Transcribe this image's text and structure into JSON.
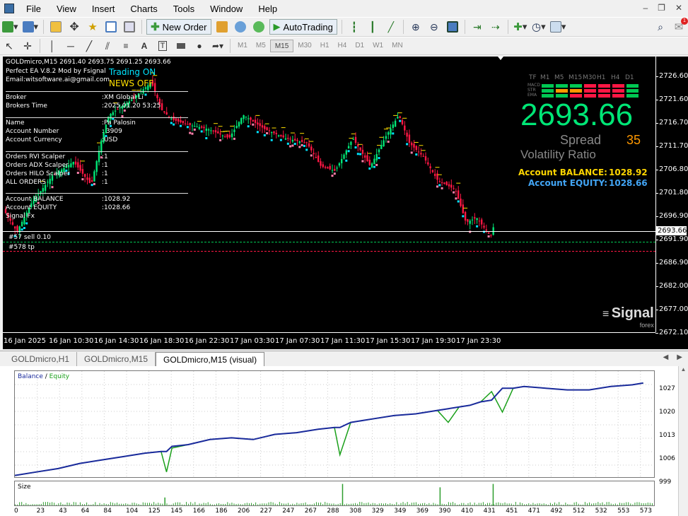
{
  "menu": [
    "File",
    "View",
    "Insert",
    "Charts",
    "Tools",
    "Window",
    "Help"
  ],
  "toolbar": {
    "new_order": "New Order",
    "autotrading": "AutoTrading"
  },
  "timeframes": [
    "M1",
    "M5",
    "M15",
    "M30",
    "H1",
    "H4",
    "D1",
    "W1",
    "MN"
  ],
  "active_timeframe": "M15",
  "chart": {
    "header": "GOLDmicro,M15  2691.40 2693.75 2691.25 2693.66",
    "ea_name": "Perfect EA V.8.2 Mod by Fsignal",
    "email": "Email:witsoftware.ai@gmail.com",
    "trading_status": "Trading ON",
    "news_status": "NEWS OFF",
    "info_rows": [
      {
        "label": "Broker",
        "value": ":XM Global Li"
      },
      {
        "label": "Brokers Time",
        "value": ":2025.01.20  53:25"
      },
      {
        "label": "Name",
        "value": ":Pa        Palosin"
      },
      {
        "label": "Account Number",
        "value": ":    3909"
      },
      {
        "label": "Account Currency",
        "value": ":USD"
      },
      {
        "label": "Orders RVI Scalper",
        "value": ":1"
      },
      {
        "label": "Orders ADX Scalper",
        "value": ":1"
      },
      {
        "label": "Orders HILO Scalper",
        "value": ":1"
      },
      {
        "label": "ALL ORDERS",
        "value": ":1"
      },
      {
        "label": "Account BALANCE",
        "value": ":1028.92"
      },
      {
        "label": "Account EQUITY",
        "value": ":1028.66"
      },
      {
        "label": "Signal Fx",
        "value": ""
      }
    ],
    "order_labels": [
      "#57 sell 0.10",
      "#578 tp"
    ],
    "tf_header": [
      "TF",
      "M1",
      "M5",
      "M15",
      "M30",
      "H1",
      "H4",
      "D1"
    ],
    "indicator_rows": [
      "MACD",
      "STR",
      "EMA"
    ],
    "big_price": "2693.66",
    "spread_label": "Spread",
    "spread_value": "35",
    "volatility_label": "Volatility Ratio",
    "balance_label": "Account BALANCE:",
    "balance_value": "1028.92",
    "equity_label": "Account EQUITY:",
    "equity_value": "1028.66",
    "logo_text": "Signal",
    "logo_sub": "forex",
    "price_labels": [
      "2726.60",
      "2721.60",
      "2716.70",
      "2711.70",
      "2706.80",
      "2701.80",
      "2696.90",
      "2691.90",
      "2686.90",
      "2682.00",
      "2677.00",
      "2672.10"
    ],
    "current_price": "2693.66",
    "time_labels": [
      "16 Jan 2025",
      "16 Jan 10:30",
      "16 Jan 14:30",
      "16 Jan 18:30",
      "16 Jan 22:30",
      "17 Jan 03:30",
      "17 Jan 07:30",
      "17 Jan 11:30",
      "17 Jan 15:30",
      "17 Jan 19:30",
      "17 Jan 23:30"
    ],
    "colors": {
      "bull": "#00e676",
      "bear": "#ff1744",
      "cyan": "#00e5ff",
      "yellow": "#ffe000"
    }
  },
  "tabs": [
    "GOLDmicro,H1",
    "GOLDmicro,M15",
    "GOLDmicro,M15 (visual)"
  ],
  "active_tab": "GOLDmicro,M15 (visual)",
  "report": {
    "legend_balance": "Balance",
    "legend_sep": " / ",
    "legend_equity": "Equity",
    "size_label": "Size",
    "y_labels": [
      "1027",
      "1020",
      "1013",
      "1006",
      "999"
    ],
    "x_labels": [
      "0",
      "23",
      "43",
      "64",
      "84",
      "104",
      "125",
      "145",
      "166",
      "186",
      "206",
      "227",
      "247",
      "267",
      "288",
      "308",
      "329",
      "349",
      "369",
      "390",
      "410",
      "431",
      "451",
      "471",
      "492",
      "512",
      "532",
      "553",
      "573"
    ],
    "colors": {
      "balance": "#1a2a9c",
      "equity": "#1aa01a"
    },
    "balance_equity_chart": {
      "type": "line",
      "x": [
        0,
        20,
        40,
        60,
        80,
        100,
        120,
        135,
        140,
        145,
        160,
        180,
        200,
        220,
        240,
        260,
        280,
        295,
        300,
        310,
        330,
        350,
        370,
        390,
        400,
        410,
        420,
        430,
        440,
        450,
        460,
        470,
        490,
        510,
        530,
        550,
        570,
        580
      ],
      "equity": [
        999.5,
        1000.5,
        1001.5,
        1003,
        1004,
        1005,
        1006,
        1006.5,
        1000.5,
        1007.5,
        1008.5,
        1010,
        1010.5,
        1010,
        1011.5,
        1012,
        1013,
        1013.5,
        1005.5,
        1015,
        1016,
        1017,
        1017.5,
        1018.5,
        1015,
        1019.5,
        1020,
        1021,
        1024,
        1018,
        1025,
        1025.5,
        1025,
        1024.5,
        1024.5,
        1025.5,
        1026,
        1026.5
      ],
      "balance": [
        999.5,
        1000.5,
        1001.5,
        1003,
        1004,
        1005,
        1006,
        1006.5,
        1006.5,
        1008,
        1008.5,
        1010,
        1010.5,
        1010,
        1011.5,
        1012,
        1013,
        1013.5,
        1013.5,
        1015,
        1016,
        1017,
        1017.5,
        1018.5,
        1019,
        1019.5,
        1020,
        1021,
        1021.5,
        1025,
        1025,
        1025.5,
        1025,
        1024.5,
        1024.5,
        1025.5,
        1026,
        1026.5
      ],
      "ylim": [
        999,
        1030
      ],
      "xlim": [
        0,
        590
      ]
    },
    "size_chart": {
      "type": "bar",
      "spikes": [
        [
          138,
          0.35
        ],
        [
          302,
          0.95
        ],
        [
          392,
          0.8
        ],
        [
          441,
          0.95
        ]
      ]
    }
  }
}
